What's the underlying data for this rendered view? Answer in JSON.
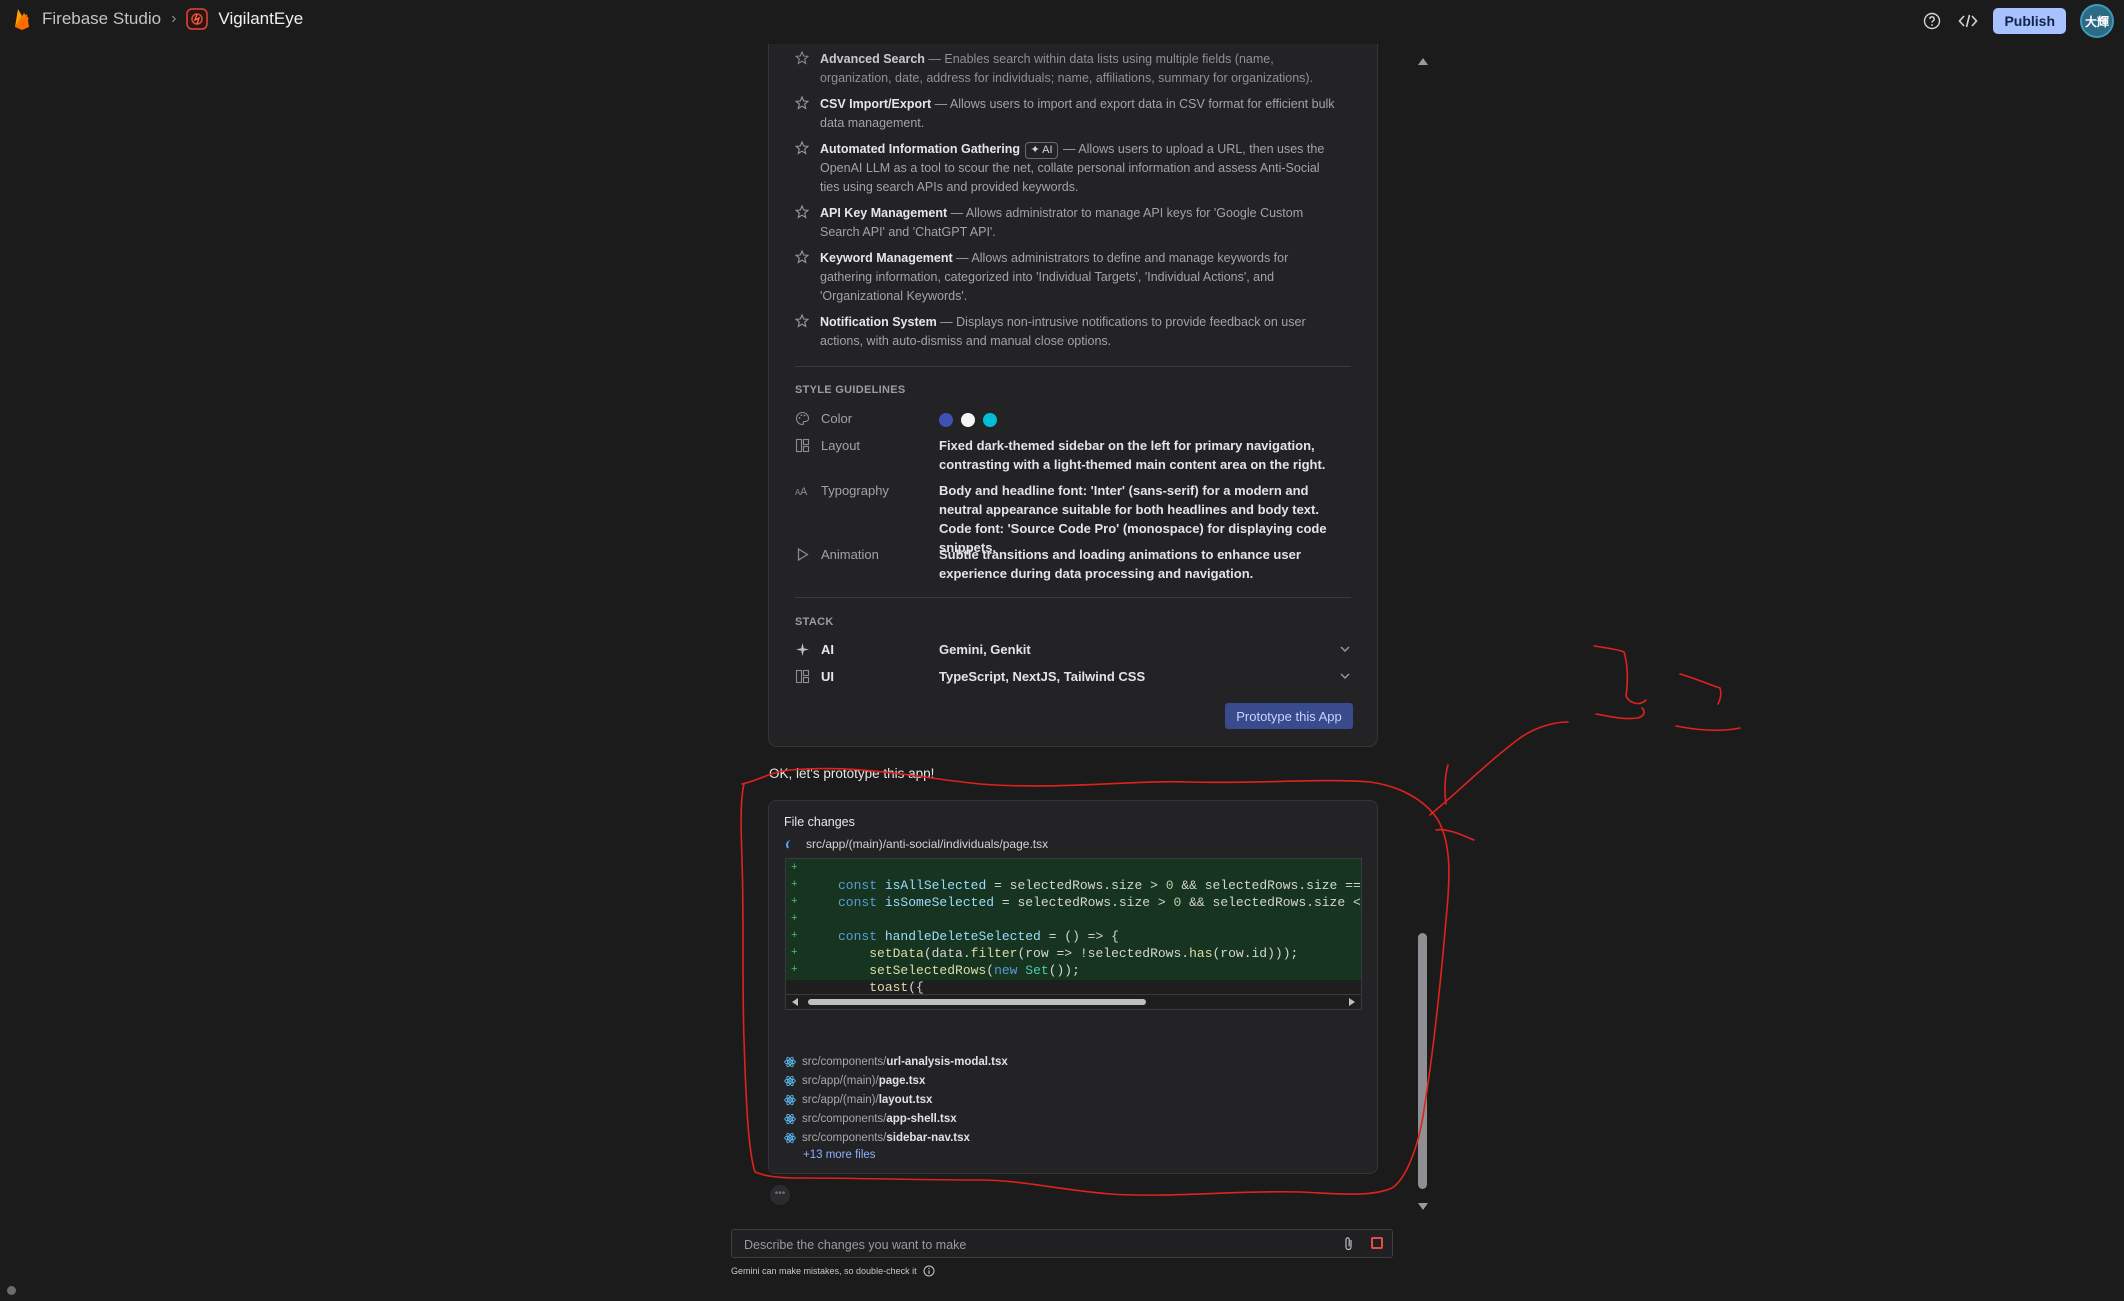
{
  "topbar": {
    "root": "Firebase Studio",
    "separator": "›",
    "project": "VigilantEye",
    "publish": "Publish",
    "avatar": "大輝",
    "icons": [
      "help-icon",
      "code-icon"
    ]
  },
  "features": [
    {
      "name": "Advanced Search",
      "desc": " — Enables search within data lists using multiple fields (name, organization, date, address for individuals; name, affiliations, summary for organizations)."
    },
    {
      "name": "CSV Import/Export",
      "desc": " — Allows users to import and export data in CSV format for efficient bulk data management."
    },
    {
      "name": "Automated Information Gathering",
      "chip": "✦ AI",
      "desc": " — Allows users to upload a URL, then uses the OpenAI LLM as a tool to scour the net, collate personal information and assess Anti-Social ties using search APIs and provided keywords."
    },
    {
      "name": "API Key Management",
      "desc": " — Allows administrator to manage API keys for 'Google Custom Search API' and 'ChatGPT API'."
    },
    {
      "name": "Keyword Management",
      "desc": " — Allows administrators to define and manage keywords for gathering information, categorized into 'Individual Targets', 'Individual Actions', and 'Organizational Keywords'."
    },
    {
      "name": "Notification System",
      "desc": " — Displays non-intrusive notifications to provide feedback on user actions, with auto-dismiss and manual close options."
    }
  ],
  "style": {
    "title": "STYLE GUIDELINES",
    "color_label": "Color",
    "colors": [
      "#3f51b5",
      "#f5f5f5",
      "#00bcd4"
    ],
    "layout_label": "Layout",
    "layout_value": "Fixed dark-themed sidebar on the left for primary navigation, contrasting with a light-themed main content area on the right.",
    "typography_label": "Typography",
    "typography_value": "Body and headline font: 'Inter' (sans-serif) for a modern and neutral appearance suitable for both headlines and body text. Code font: 'Source Code Pro' (monospace) for displaying code snippets.",
    "animation_label": "Animation",
    "animation_value": "Subtle transitions and loading animations to enhance user experience during data processing and navigation."
  },
  "stack": {
    "title": "STACK",
    "ai_label": "AI",
    "ai_value": "Gemini, Genkit",
    "ui_label": "UI",
    "ui_value": "TypeScript, NextJS, Tailwind CSS"
  },
  "prototype_button": "Prototype this App",
  "message": "OK, let's prototype this app!",
  "file_changes": {
    "title": "File changes",
    "current_path": "src/app/(main)/anti-social/individuals/page.tsx",
    "files": [
      {
        "dir": "src/components/",
        "file": "url-analysis-modal.tsx"
      },
      {
        "dir": "src/app/(main)/",
        "file": "page.tsx"
      },
      {
        "dir": "src/app/(main)/",
        "file": "layout.tsx"
      },
      {
        "dir": "src/components/",
        "file": "app-shell.tsx"
      },
      {
        "dir": "src/components/",
        "file": "sidebar-nav.tsx"
      }
    ],
    "more": "+13 more files"
  },
  "input": {
    "placeholder": "Describe the changes you want to make",
    "disclaimer": "Gemini can make mistakes, so double-check it"
  }
}
